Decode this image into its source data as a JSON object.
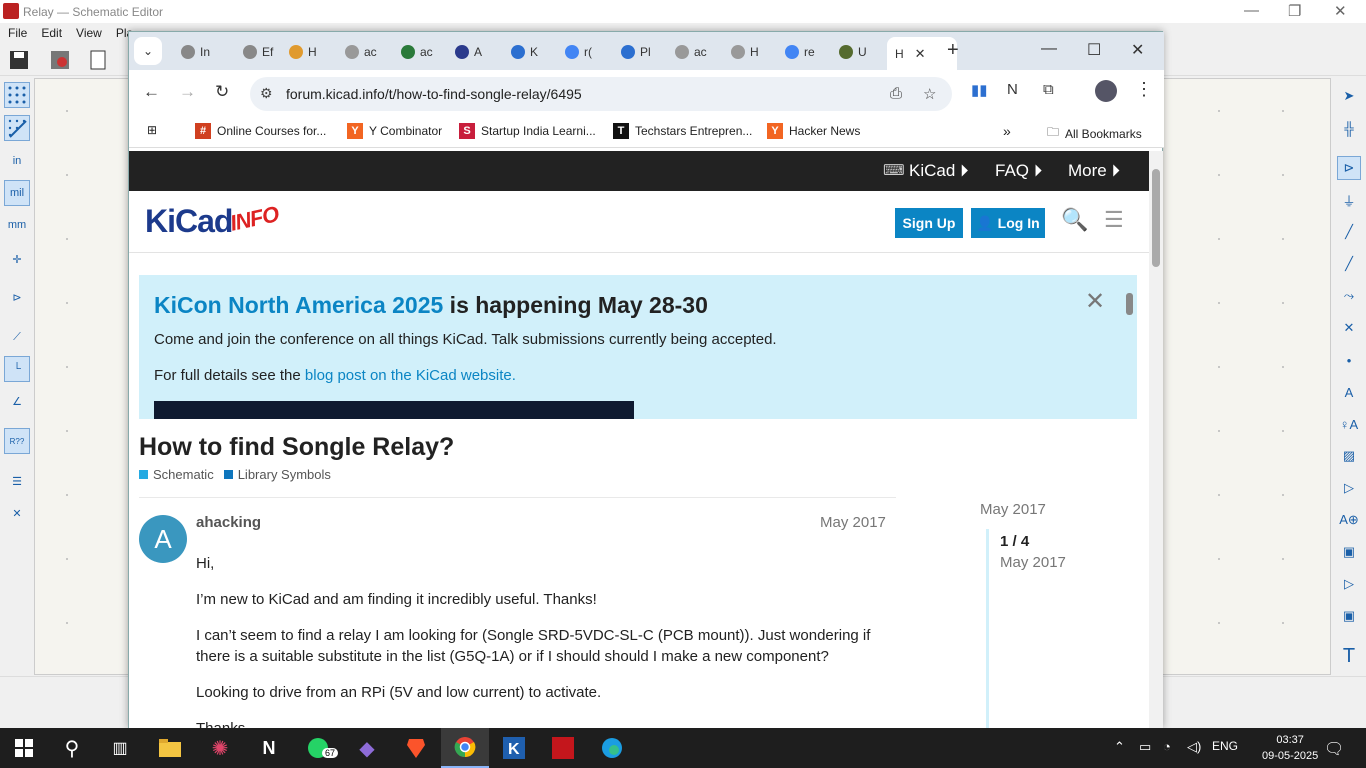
{
  "kicad": {
    "window_title": "Relay — Schematic Editor",
    "menus": [
      "File",
      "Edit",
      "View",
      "Pla"
    ],
    "left_tools": [
      "grid-dots",
      "grid-overrides",
      "in",
      "mil",
      "mm",
      "cursor-crosshair",
      "hierarchy-nav",
      "net-highlight",
      "line-modes",
      "ortho",
      "annotate",
      "symbol-fields",
      "properties"
    ],
    "right_tools": [
      "select",
      "highlight-net",
      "add-symbol",
      "add-power",
      "add-wire",
      "add-bus",
      "bus-entry",
      "no-connect",
      "junction",
      "net-label",
      "global-label",
      "hier-label",
      "sheet",
      "sheet-pin",
      "import-sheet-pin",
      "add-text",
      "add-textbox",
      "add-image",
      "add-text-T"
    ]
  },
  "browser": {
    "tabs": [
      {
        "label": "In",
        "icon": "web-icon",
        "color": "#888"
      },
      {
        "label": "Ef",
        "icon": "web-icon",
        "color": "#888"
      },
      {
        "label": "H",
        "icon": "ycomb-icon",
        "color": "#e09a2e"
      },
      {
        "label": "ac",
        "icon": "web-icon",
        "color": "#999"
      },
      {
        "label": "ac",
        "icon": "chip-icon",
        "color": "#2a7a3a"
      },
      {
        "label": "A",
        "icon": "kicad-icon",
        "color": "#2b3a8c"
      },
      {
        "label": "K",
        "icon": "h-icon",
        "color": "#2c6fd0"
      },
      {
        "label": "r(",
        "icon": "google-icon",
        "color": "#4285f4"
      },
      {
        "label": "Pl",
        "icon": "h-icon",
        "color": "#2c6fd0"
      },
      {
        "label": "ac",
        "icon": "web-icon",
        "color": "#999"
      },
      {
        "label": "H",
        "icon": "web-icon",
        "color": "#999"
      },
      {
        "label": "re",
        "icon": "google-icon",
        "color": "#4285f4"
      },
      {
        "label": "U",
        "icon": "web-icon",
        "color": "#556b2f"
      }
    ],
    "active_tab": {
      "label": "H",
      "close": "✕"
    },
    "url": "forum.kicad.info/t/how-to-find-songle-relay/6495",
    "bookmarks": [
      {
        "label": "Online Courses for...",
        "icon": "#",
        "color": "#d04020"
      },
      {
        "label": "Y Combinator",
        "icon": "Y",
        "color": "#f26522"
      },
      {
        "label": "Startup India Learni...",
        "icon": "S",
        "color": "#c81e3c"
      },
      {
        "label": "Techstars Entrepren...",
        "icon": "T",
        "color": "#111"
      },
      {
        "label": "Hacker News",
        "icon": "Y",
        "color": "#f26522"
      }
    ],
    "more_bookmarks": "»",
    "all_bookmarks": "All Bookmarks"
  },
  "forum": {
    "topnav": [
      "KiCad",
      "FAQ",
      "More"
    ],
    "logo_main": "KiCad",
    "logo_sub": "INFO",
    "sign_up": "Sign Up",
    "log_in": "Log In",
    "banner": {
      "title_link": "KiCon North America 2025",
      "title_rest": " is happening May 28-30",
      "p1": "Come and join the conference on all things KiCad. Talk submissions currently being accepted.",
      "p2_text": "For full details see the ",
      "p2_link": "blog post on the KiCad website.",
      "close": "✕"
    },
    "topic_title": "How to find Songle Relay?",
    "categories": [
      {
        "label": "Schematic",
        "color": "#25aae2"
      },
      {
        "label": "Library Symbols",
        "color": "#0e76bd"
      }
    ],
    "post": {
      "avatar_letter": "A",
      "username": "ahacking",
      "date": "May 2017",
      "paragraphs": [
        "Hi,",
        "I’m new to KiCad and am finding it incredibly useful. Thanks!",
        "I can’t seem to find a relay I am looking for (Songle SRD-5VDC-SL-C (PCB mount)). Just wondering if there is a suitable substitute in the list (G5Q-1A) or if I should should I make a new component?",
        "Looking to drive from an RPi (5V and low current) to activate.",
        "Thanks"
      ]
    },
    "timeline": {
      "top": "May 2017",
      "count": "1 / 4",
      "date": "May 2017"
    }
  },
  "taskbar": {
    "whatsapp_badge": "67",
    "lang": "ENG",
    "time": "03:37",
    "date": "09-05-2025"
  }
}
